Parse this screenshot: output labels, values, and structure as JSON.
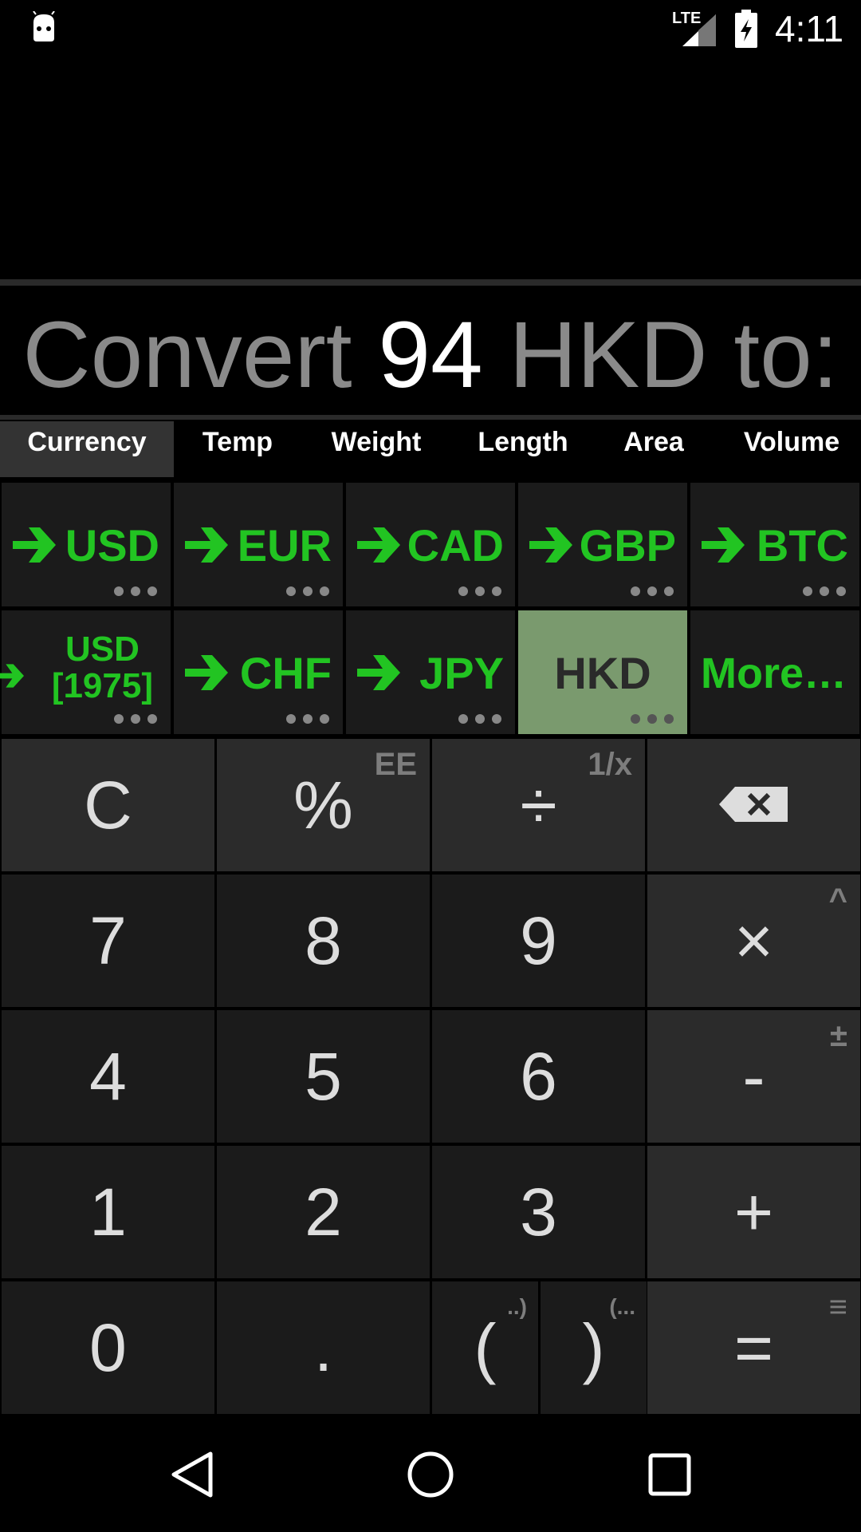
{
  "status_bar": {
    "time": "4:11",
    "network": "LTE"
  },
  "display": {
    "prefix": "Convert",
    "amount": "94",
    "suffix": "HKD to:"
  },
  "tabs": [
    {
      "label": "Currency",
      "active": true
    },
    {
      "label": "Temp"
    },
    {
      "label": "Weight"
    },
    {
      "label": "Length"
    },
    {
      "label": "Area"
    },
    {
      "label": "Volume"
    }
  ],
  "currencies": {
    "row1": [
      "USD",
      "EUR",
      "CAD",
      "GBP",
      "BTC"
    ],
    "row2": [
      "USD",
      "[1975]",
      "CHF",
      "JPY",
      "HKD",
      "More…"
    ]
  },
  "keypad": {
    "clear": "C",
    "percent": "%",
    "percent_alt": "EE",
    "divide": "÷",
    "divide_alt": "1/x",
    "seven": "7",
    "eight": "8",
    "nine": "9",
    "multiply": "×",
    "multiply_alt": "^",
    "four": "4",
    "five": "5",
    "six": "6",
    "minus": "-",
    "minus_alt": "±",
    "one": "1",
    "two": "2",
    "three": "3",
    "plus": "+",
    "zero": "0",
    "dot": ".",
    "open_paren": "(",
    "open_paren_alt": "..)",
    "close_paren": ")",
    "close_paren_alt": "(...",
    "equals": "=",
    "equals_alt": "≡"
  },
  "colors": {
    "accent": "#22c422",
    "selected_bg": "#7a9a6e"
  }
}
